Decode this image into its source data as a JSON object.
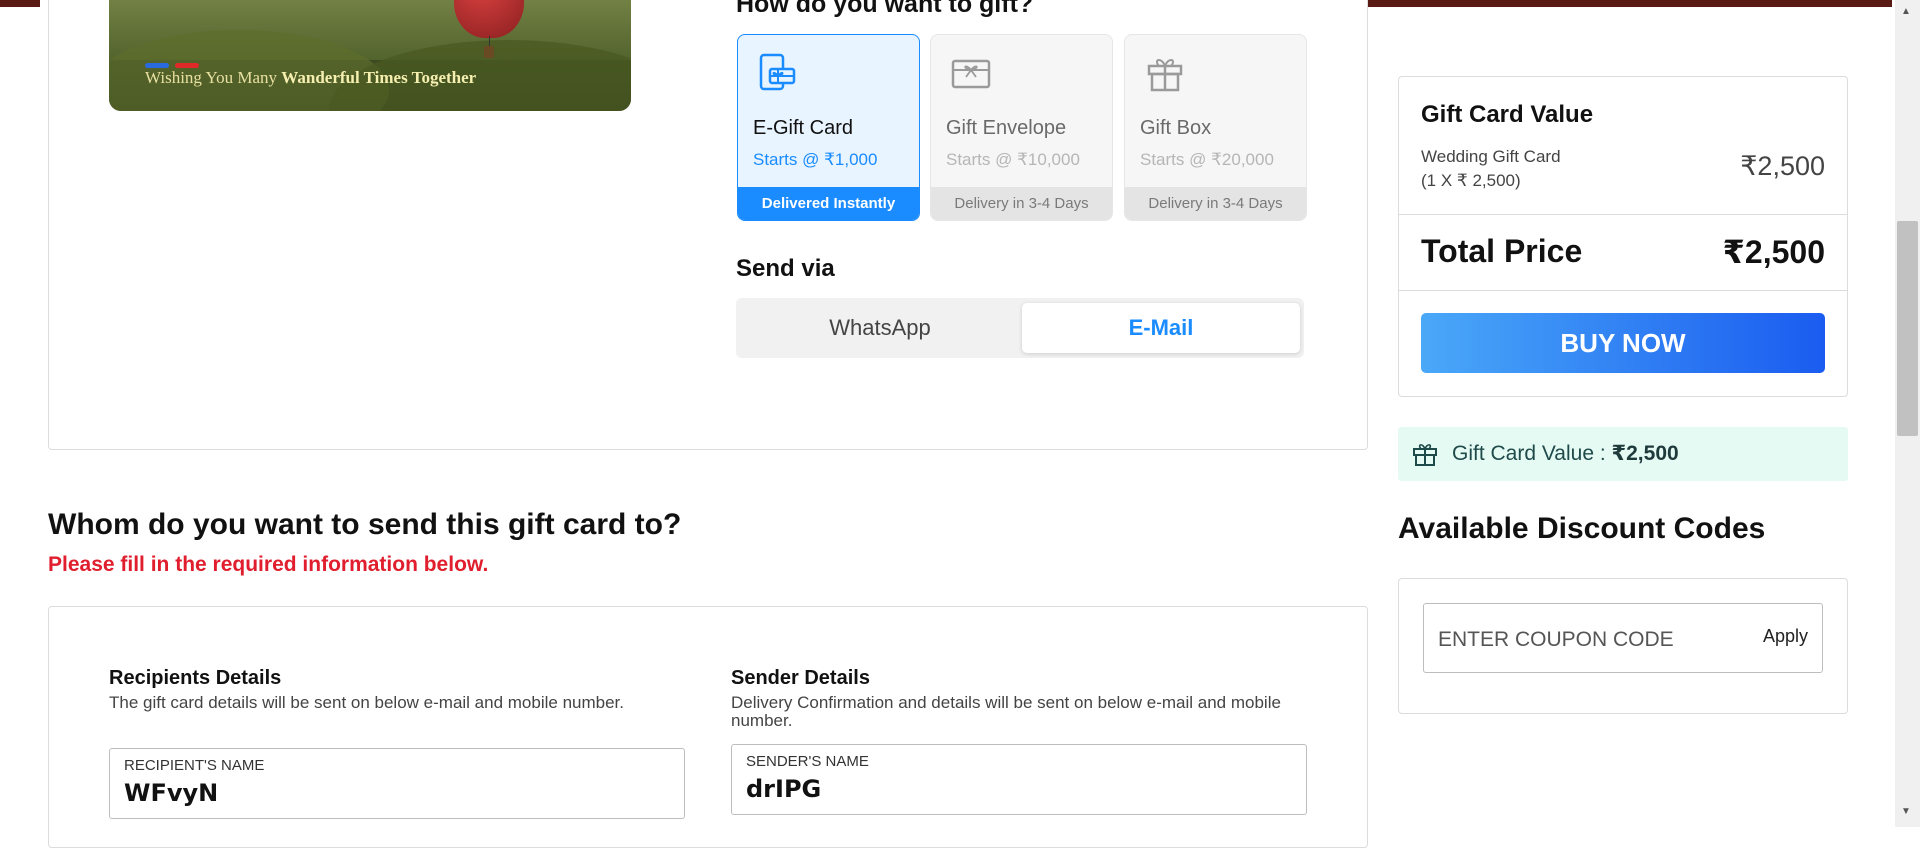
{
  "hero": {
    "caption_prefix": "Wishing You Many ",
    "caption_bold": "Wanderful Times Together",
    "dot_colors": [
      "#2a6adf",
      "#e02a2a"
    ]
  },
  "gift_method": {
    "heading": "How do you want to gift?",
    "options": [
      {
        "title": "E-Gift Card",
        "price": "Starts @ ₹1,000",
        "delivery": "Delivered Instantly",
        "icon": "phone-gift-icon",
        "selected": true
      },
      {
        "title": "Gift Envelope",
        "price": "Starts @ ₹10,000",
        "delivery": "Delivery in 3-4 Days",
        "icon": "envelope-gift-icon",
        "selected": false
      },
      {
        "title": "Gift Box",
        "price": "Starts @ ₹20,000",
        "delivery": "Delivery in 3-4 Days",
        "icon": "gift-box-icon",
        "selected": false
      }
    ]
  },
  "send_via": {
    "heading": "Send via",
    "options": [
      "WhatsApp",
      "E-Mail"
    ],
    "selected": "E-Mail"
  },
  "recipient_section": {
    "heading": "Whom do you want to send this gift card to?",
    "warning": "Please fill in the required information below.",
    "recipients": {
      "title": "Recipients Details",
      "desc": "The gift card details will be sent on below e-mail and mobile number.",
      "name_label": "RECIPIENT'S NAME",
      "name_value": "WFvyN"
    },
    "sender": {
      "title": "Sender Details",
      "desc": "Delivery Confirmation and details will be sent on below e-mail and mobile number.",
      "name_label": "SENDER'S NAME",
      "name_value": "drIPG"
    }
  },
  "summary": {
    "heading": "Gift Card Value",
    "item_name": "Wedding Gift Card",
    "item_qty": "(1 X ₹ 2,500)",
    "item_amount": "₹2,500",
    "total_label": "Total Price",
    "total_amount": "₹2,500",
    "buy_label": "BUY NOW"
  },
  "gift_value_banner": {
    "label": "Gift Card Value : ",
    "amount": "₹2,500",
    "icon": "gift-icon"
  },
  "discounts": {
    "heading": "Available Discount Codes",
    "coupon_placeholder": "ENTER COUPON CODE",
    "apply_label": "Apply"
  },
  "colors": {
    "accent": "#1a8cff",
    "warning": "#e01e2d",
    "buy_gradient_start": "#4aa8f8",
    "buy_gradient_end": "#1a5cf0",
    "banner_bg": "#e6faf4"
  }
}
